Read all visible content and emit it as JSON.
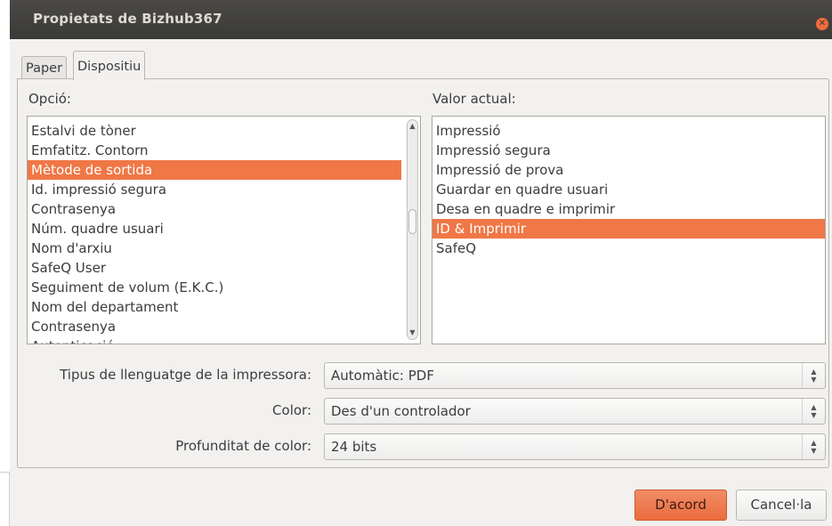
{
  "window": {
    "title": "Propietats de Bizhub367",
    "close_icon": "close-icon"
  },
  "tabs": [
    {
      "label": "Paper",
      "active": false
    },
    {
      "label": "Dispositiu",
      "active": true
    }
  ],
  "options": {
    "header": "Opció:",
    "items": [
      "Estalvi de tòner",
      "Emfatitz. Contorn",
      "Mètode de sortida",
      "Id. impressió segura",
      "Contrasenya",
      "Núm. quadre usuari",
      "Nom d'arxiu",
      "SafeQ User",
      "Seguiment de volum (E.K.C.)",
      "Nom del departament",
      "Contrasenya",
      "Autenticació"
    ],
    "selected_index": 2
  },
  "values": {
    "header": "Valor actual:",
    "items": [
      "Impressió",
      "Impressió segura",
      "Impressió de prova",
      "Guardar en quadre usuari",
      "Desa en quadre e imprimir",
      "ID & Imprimir",
      "SafeQ"
    ],
    "selected_index": 5
  },
  "settings": [
    {
      "label": "Tipus de llenguatge de la impressora:",
      "value": "Automàtic: PDF"
    },
    {
      "label": "Color:",
      "value": "Des d'un controlador"
    },
    {
      "label": "Profunditat de color:",
      "value": "24 bits"
    }
  ],
  "buttons": {
    "ok": "D'acord",
    "cancel": "Cancel·la"
  },
  "colors": {
    "accent": "#f07746",
    "titlebar": "#3b3a36"
  }
}
